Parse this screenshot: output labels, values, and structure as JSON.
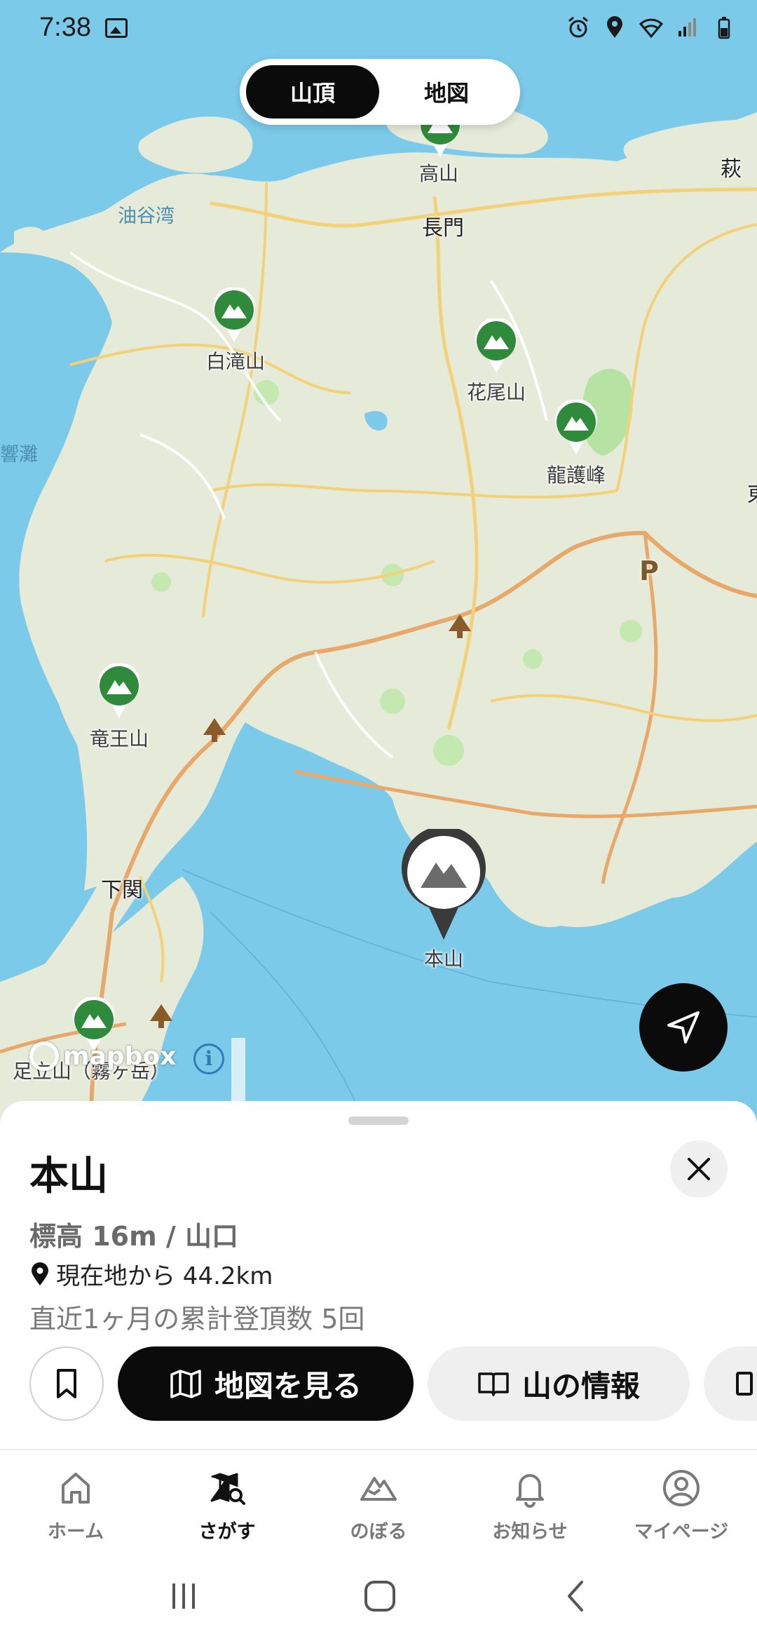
{
  "status_bar": {
    "time": "7:38"
  },
  "toggle": {
    "active_label": "山頂",
    "inactive_label": "地図"
  },
  "map": {
    "peaks": [
      {
        "name": "高山"
      },
      {
        "name": "白滝山"
      },
      {
        "name": "花尾山"
      },
      {
        "name": "龍護峰"
      },
      {
        "name": "竜王山"
      },
      {
        "name": "足立山（霧ヶ岳）"
      }
    ],
    "selected_peak": "本山",
    "places": {
      "nagato": "長門",
      "hagi": "萩",
      "shimonoseki": "下関",
      "p_marker": "P",
      "east_edge": "東"
    },
    "water": {
      "yuya_bay": "油谷湾",
      "hibikinada": "響灘"
    },
    "attribution": "mapbox"
  },
  "sheet": {
    "title": "本山",
    "elevation": "標高 16m / 山口",
    "distance": "現在地から 44.2km",
    "climbs": "直近1ヶ月の累計登頂数 5回",
    "view_map_label": "地図を見る",
    "info_label": "山の情報"
  },
  "nav": {
    "home": "ホーム",
    "search": "さがす",
    "climb": "のぼる",
    "notifications": "お知らせ",
    "mypage": "マイページ"
  },
  "colors": {
    "sea": "#7ccaea",
    "land": "#e6ead9",
    "pin_green": "#2f8a3b",
    "primary": "#0b0b0b"
  }
}
